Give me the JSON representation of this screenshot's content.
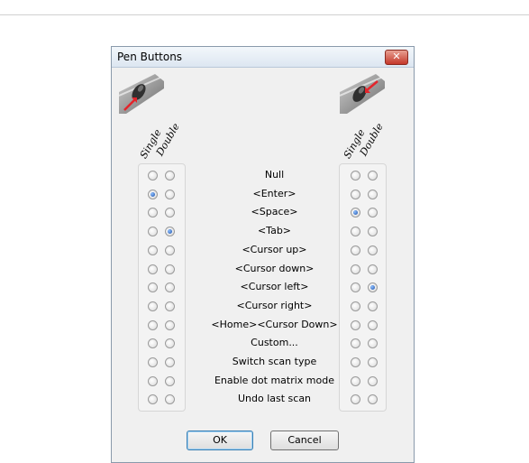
{
  "dialog": {
    "title": "Pen Buttons",
    "close_glyph": "✕"
  },
  "columns": {
    "single": "Single",
    "double": "Double"
  },
  "actions": [
    "Null",
    "<Enter>",
    "<Space>",
    "<Tab>",
    "<Cursor up>",
    "<Cursor down>",
    "<Cursor left>",
    "<Cursor right>",
    "<Home><Cursor Down>",
    "Custom...",
    "Switch scan type",
    "Enable dot matrix mode",
    "Undo last scan"
  ],
  "left_selection": {
    "single_index": 1,
    "double_index": 3
  },
  "right_selection": {
    "single_index": 2,
    "double_index": 6
  },
  "buttons": {
    "ok": "OK",
    "cancel": "Cancel"
  },
  "icons": {
    "left_pen": "pen-lower-button-icon",
    "right_pen": "pen-upper-button-icon",
    "close": "close-icon"
  },
  "colors": {
    "selected_radio": "#1b4fa8",
    "pointer_arrow": "#e3242b"
  }
}
